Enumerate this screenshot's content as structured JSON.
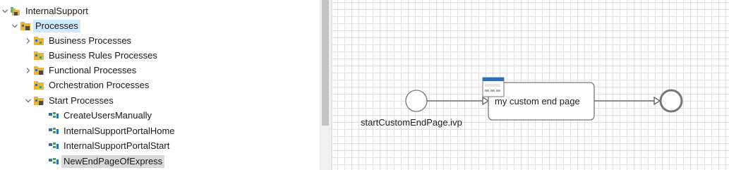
{
  "tree": {
    "items": [
      {
        "label": "InternalSupport"
      },
      {
        "label": "Processes"
      },
      {
        "label": "Business Processes"
      },
      {
        "label": "Business Rules Processes"
      },
      {
        "label": "Functional Processes"
      },
      {
        "label": "Orchestration Processes"
      },
      {
        "label": "Start Processes"
      },
      {
        "label": "CreateUsersManually"
      },
      {
        "label": "InternalSupportPortalHome"
      },
      {
        "label": "InternalSupportPortalStart"
      },
      {
        "label": "NewEndPageOfExpress"
      }
    ]
  },
  "canvas": {
    "start_event_label": "startCustomEndPage.ivp",
    "task_label": "my custom end page"
  },
  "colors": {
    "folder_yellow": "#e9b43c",
    "process_blue": "#2f6fb3",
    "process_green": "#3aa655",
    "selection": "#d9d9d9",
    "highlight": "#cde8ff"
  }
}
